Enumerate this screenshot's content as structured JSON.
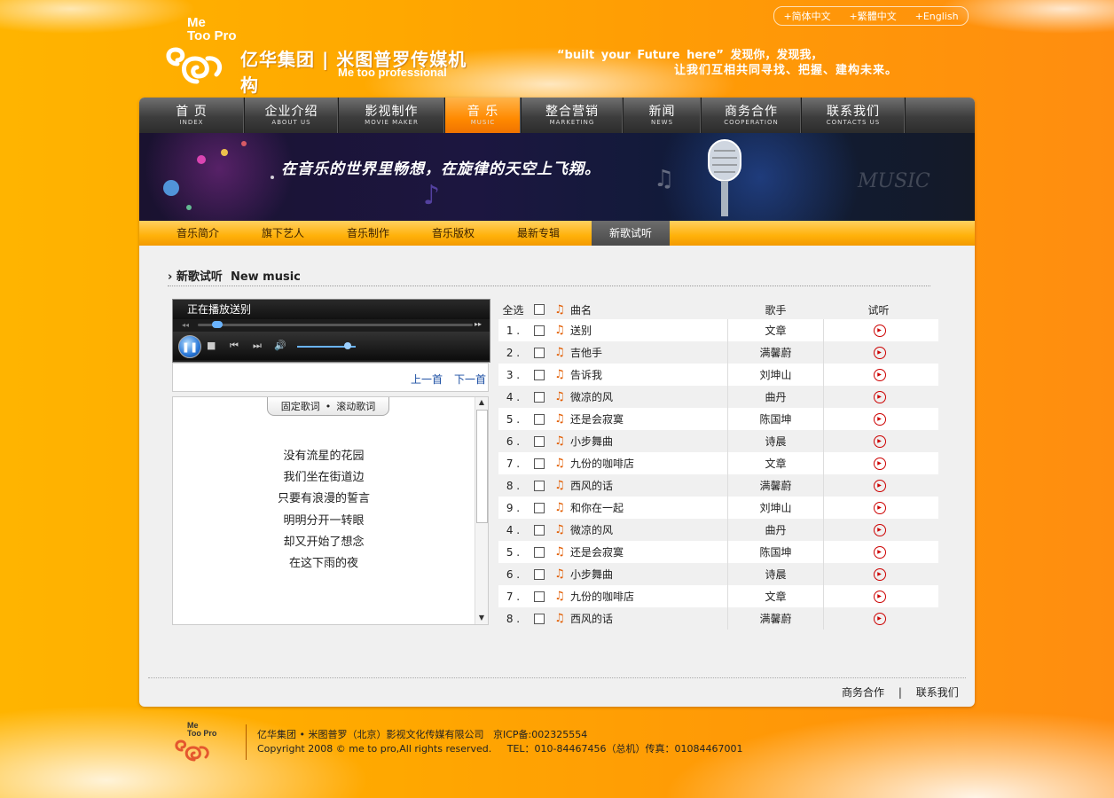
{
  "header": {
    "lang": [
      "+简体中文",
      "+繁體中文",
      "+English"
    ],
    "logo_small": "Me\nToo Pro",
    "company_cn": "亿华集团 | 米图普罗传媒机构",
    "company_en": "Me too professional",
    "slogan_line1": "“built your Future here” 发现你，发现我，",
    "slogan_line2": "让我们互相共同寻找、把握、建构未来。"
  },
  "nav": [
    {
      "cn": "首 页",
      "en": "INDEX"
    },
    {
      "cn": "企业介绍",
      "en": "ABOUT US"
    },
    {
      "cn": "影视制作",
      "en": "MOVIE MAKER"
    },
    {
      "cn": "音 乐",
      "en": "MUSIC"
    },
    {
      "cn": "整合营销",
      "en": "MARKETING"
    },
    {
      "cn": "新闻",
      "en": "NEWS"
    },
    {
      "cn": "商务合作",
      "en": "COOPERATION"
    },
    {
      "cn": "联系我们",
      "en": "CONTACTS US"
    }
  ],
  "banner": {
    "text": "在音乐的世界里畅想，在旋律的天空上飞翔。",
    "word": "MUSIC"
  },
  "subnav": [
    "音乐简介",
    "旗下艺人",
    "音乐制作",
    "音乐版权",
    "最新专辑",
    "新歌试听"
  ],
  "section": {
    "title": "新歌试听  New music"
  },
  "player": {
    "now_playing": "正在播放送别",
    "prev": "上一首",
    "next": "下一首",
    "progress": 0.05,
    "volume": 0.8
  },
  "lyrics": {
    "tab_fixed": "固定歌词",
    "tab_sep": "•",
    "tab_scroll": "滚动歌词",
    "lines": [
      "没有流星的花园",
      "我们坐在街道边",
      "只要有浪漫的誓言",
      "明明分开一转眼",
      "却又开始了想念",
      "在这下雨的夜"
    ]
  },
  "table": {
    "select_all": "全选",
    "col_name": "曲名",
    "col_artist": "歌手",
    "col_play": "试听",
    "rows": [
      {
        "num": "1 .",
        "name": "送别",
        "artist": "文章"
      },
      {
        "num": "2 .",
        "name": "吉他手",
        "artist": "满馨蔚"
      },
      {
        "num": "3 .",
        "name": "告诉我",
        "artist": "刘坤山"
      },
      {
        "num": "4 .",
        "name": "微凉的风",
        "artist": "曲丹"
      },
      {
        "num": "5 .",
        "name": "还是会寂寞",
        "artist": "陈国坤"
      },
      {
        "num": "6 .",
        "name": "小步舞曲",
        "artist": "诗晨"
      },
      {
        "num": "7 .",
        "name": "九份的咖啡店",
        "artist": "文章"
      },
      {
        "num": "8 .",
        "name": "西风的话",
        "artist": "满馨蔚"
      },
      {
        "num": "9 .",
        "name": "和你在一起",
        "artist": "刘坤山"
      },
      {
        "num": "4 .",
        "name": "微凉的风",
        "artist": "曲丹"
      },
      {
        "num": "5 .",
        "name": "还是会寂寞",
        "artist": "陈国坤"
      },
      {
        "num": "6 .",
        "name": "小步舞曲",
        "artist": "诗晨"
      },
      {
        "num": "7 .",
        "name": "九份的咖啡店",
        "artist": "文章"
      },
      {
        "num": "8 .",
        "name": "西风的话",
        "artist": "满馨蔚"
      }
    ]
  },
  "bottom_links": {
    "coop": "商务合作",
    "sep": "|",
    "contact": "联系我们"
  },
  "footer": {
    "line1": "亿华集团 • 米图普罗（北京）影视文化传媒有限公司   京ICP备:002325554",
    "line2": "Copyright 2008 © me to pro,All rights reserved.     TEL：010-84467456（总机）传真：01084467001"
  },
  "colors": {
    "accent": "#ff9a06",
    "nav_dark": "#3d3d3d",
    "play_red": "#cc0000"
  }
}
